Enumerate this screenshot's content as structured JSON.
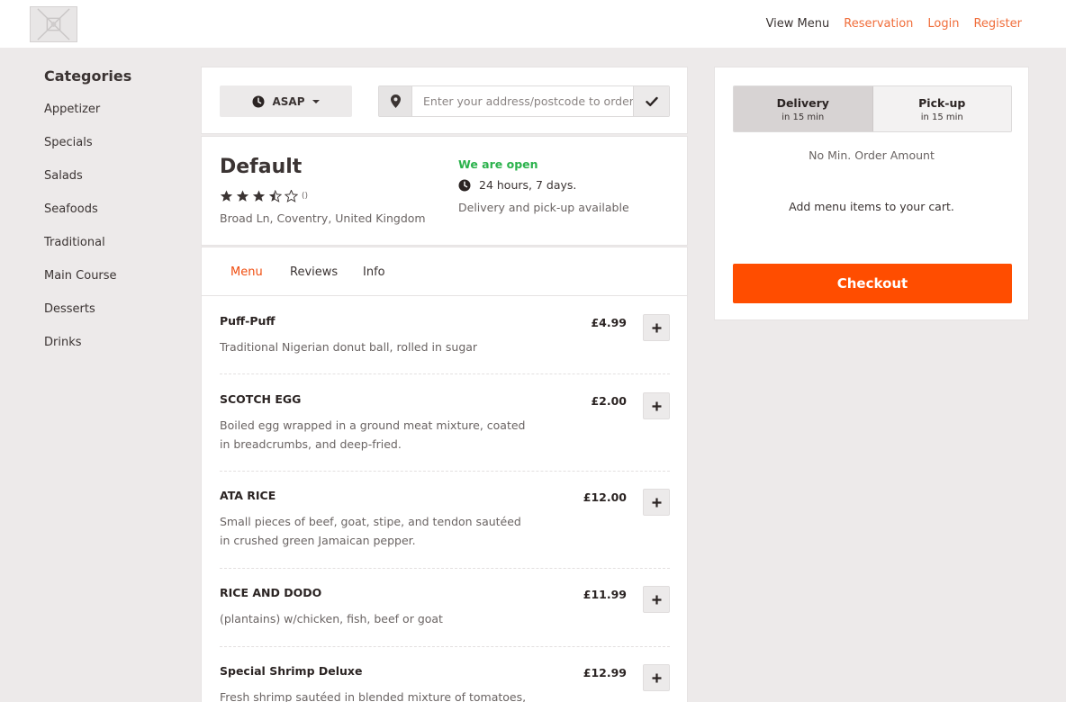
{
  "header": {
    "logo_alt": "Logo",
    "nav": {
      "view_menu": "View Menu",
      "reservation": "Reservation",
      "login": "Login",
      "register": "Register"
    }
  },
  "categories": {
    "title": "Categories",
    "items": [
      "Appetizer",
      "Specials",
      "Salads",
      "Seafoods",
      "Traditional",
      "Main Course",
      "Desserts",
      "Drinks"
    ]
  },
  "search": {
    "time_label": "ASAP",
    "address_placeholder": "Enter your address/postcode to order",
    "address_value": ""
  },
  "restaurant": {
    "name": "Default",
    "rating": 3.5,
    "rating_max": 5,
    "rating_count": "()",
    "address": "Broad Ln, Coventry, United Kingdom",
    "open_status": "We are open",
    "hours": "24 hours, 7 days.",
    "service": "Delivery and pick-up available"
  },
  "tabs": [
    "Menu",
    "Reviews",
    "Info"
  ],
  "menu_items": [
    {
      "name": "Puff-Puff",
      "description": "Traditional Nigerian donut ball, rolled in sugar",
      "price": "£4.99"
    },
    {
      "name": "SCOTCH EGG",
      "description": "Boiled egg wrapped in a ground meat mixture, coated in breadcrumbs, and deep-fried.",
      "price": "£2.00"
    },
    {
      "name": "ATA RICE",
      "description": "Small pieces of beef, goat, stipe, and tendon sautéed in crushed green Jamaican pepper.",
      "price": "£12.00"
    },
    {
      "name": "RICE AND DODO",
      "description": "(plantains) w/chicken, fish, beef or goat",
      "price": "£11.99"
    },
    {
      "name": "Special Shrimp Deluxe",
      "description": "Fresh shrimp sautéed in blended mixture of tomatoes, onion,",
      "price": "£12.99"
    }
  ],
  "cart": {
    "delivery": {
      "label": "Delivery",
      "time": "in 15 min",
      "selected": true
    },
    "pickup": {
      "label": "Pick-up",
      "time": "in 15 min",
      "selected": false
    },
    "min_order": "No Min. Order Amount",
    "empty_text": "Add menu items to your cart.",
    "checkout_label": "Checkout"
  },
  "colors": {
    "accent": "#ff4d00",
    "link": "#f06d3a",
    "open_green": "#2bb24c",
    "background": "#edeaea"
  }
}
